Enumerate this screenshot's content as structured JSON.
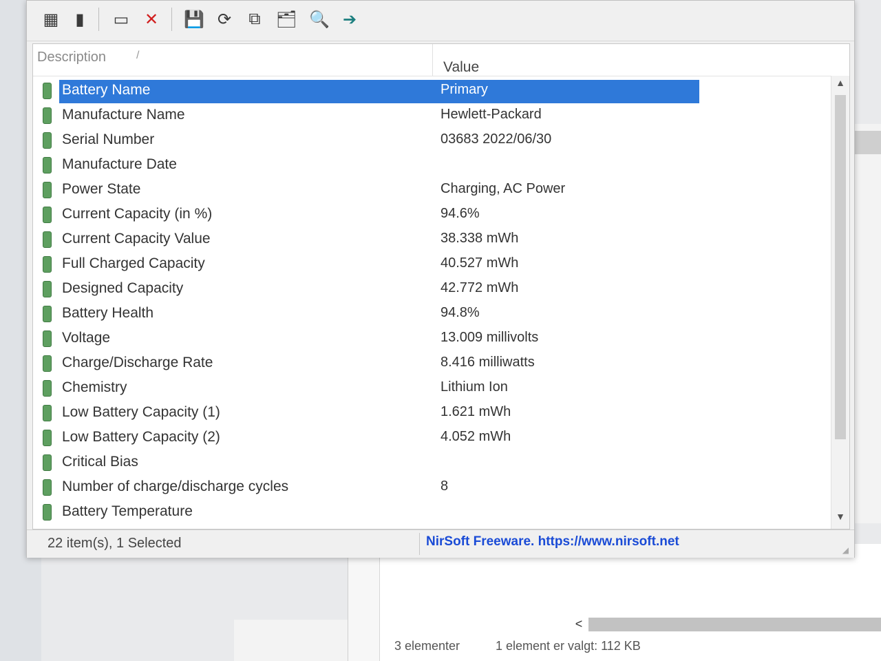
{
  "toolbar": {
    "buttons": [
      {
        "name": "properties-icon",
        "glyph": "▦"
      },
      {
        "name": "battery-info-icon",
        "glyph": "▮"
      },
      {
        "name": "window-icon",
        "glyph": "▭"
      },
      {
        "name": "delete-icon",
        "glyph": "✕"
      },
      {
        "name": "save-icon",
        "glyph": "💾"
      },
      {
        "name": "refresh-icon",
        "glyph": "⟳"
      },
      {
        "name": "copy-icon",
        "glyph": "⧉"
      },
      {
        "name": "report-icon",
        "glyph": "🗂"
      },
      {
        "name": "find-icon",
        "glyph": "🔍"
      },
      {
        "name": "exit-icon",
        "glyph": "➔"
      }
    ]
  },
  "header": {
    "description": "Description",
    "sort_indicator": "/",
    "value": "Value"
  },
  "rows": [
    {
      "description": "Battery Name",
      "value": "Primary"
    },
    {
      "description": "Manufacture Name",
      "value": "Hewlett-Packard"
    },
    {
      "description": "Serial Number",
      "value": "03683 2022/06/30"
    },
    {
      "description": "Manufacture Date",
      "value": ""
    },
    {
      "description": "Power State",
      "value": "Charging, AC Power"
    },
    {
      "description": "Current Capacity (in %)",
      "value": "94.6%"
    },
    {
      "description": "Current Capacity Value",
      "value": "38.338 mWh"
    },
    {
      "description": "Full Charged Capacity",
      "value": "40.527 mWh"
    },
    {
      "description": "Designed Capacity",
      "value": "42.772 mWh"
    },
    {
      "description": "Battery Health",
      "value": "94.8%"
    },
    {
      "description": "Voltage",
      "value": "13.009 millivolts"
    },
    {
      "description": "Charge/Discharge Rate",
      "value": "8.416 milliwatts"
    },
    {
      "description": "Chemistry",
      "value": "Lithium Ion"
    },
    {
      "description": "Low Battery Capacity (1)",
      "value": "1.621 mWh"
    },
    {
      "description": "Low Battery Capacity (2)",
      "value": "4.052 mWh"
    },
    {
      "description": "Critical Bias",
      "value": ""
    },
    {
      "description": "Number of charge/discharge cycles",
      "value": "8"
    },
    {
      "description": "Battery Temperature",
      "value": ""
    }
  ],
  "selected_row_index": 0,
  "status": {
    "items": "22 item(s), 1 Selected",
    "credit": "NirSoft Freeware. https://www.nirsoft.net"
  },
  "background_window": {
    "left_arrow": "<",
    "item_count": "3 elementer",
    "selection": "1 element er valgt: 112 KB"
  },
  "colors": {
    "selection": "#2f79d9",
    "link": "#1a4bd6",
    "battery_icon": "#5e9f60"
  }
}
